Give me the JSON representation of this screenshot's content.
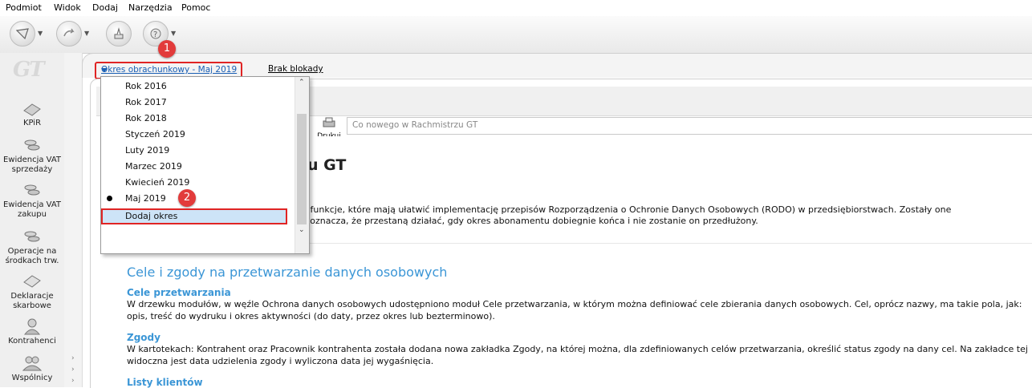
{
  "menu": [
    "Podmiot",
    "Widok",
    "Dodaj",
    "Narzędzia",
    "Pomoc"
  ],
  "toolbar": {
    "icons": [
      "mail-icon",
      "forward-icon",
      "tools-icon",
      "help-icon"
    ]
  },
  "logo": "GT",
  "nav": [
    {
      "label": "KPiR",
      "icon": "book-icon"
    },
    {
      "label": "Ewidencja VAT sprzedaży",
      "icon": "coins-icon"
    },
    {
      "label": "Ewidencja VAT zakupu",
      "icon": "coins-icon"
    },
    {
      "label": "Operacje na środkach trw.",
      "icon": "coins-icon"
    },
    {
      "label": "Deklaracje skarbowe",
      "icon": "document-icon"
    },
    {
      "label": "Kontrahenci",
      "icon": "person-icon"
    },
    {
      "label": "Wspólnicy",
      "icon": "people-icon"
    }
  ],
  "period": {
    "label": "Okres obrachunkowy - Maj 2019",
    "lock": "Brak blokady"
  },
  "dropdown": {
    "items": [
      "Rok 2016",
      "Rok 2017",
      "Rok 2018",
      "Styczeń 2019",
      "Luty 2019",
      "Marzec 2019",
      "Kwiecień 2019",
      "Maj 2019"
    ],
    "selected": "Maj 2019",
    "add": "Dodaj okres"
  },
  "markers": [
    "1",
    "2"
  ],
  "print_label": "Drukuj",
  "address": "Co nowego w Rachmistrzu GT",
  "content": {
    "title_fragment": "u GT",
    "intro_line1": "y i funkcje, które mają ułatwić implementację przepisów Rozporządzenia o Ochronie Danych Osobowych (RODO) w przedsiębiorstwach. Zostały one",
    "intro_line2": "co oznacza, że przestaną działać, gdy okres abonamentu dobiegnie końca i nie zostanie on przedłużony.",
    "section_title": "Cele i zgody na przetwarzanie danych osobowych",
    "s1_title": "Cele przetwarzania",
    "s1_line1": "W drzewku modułów, w węźle Ochrona danych osobowych udostępniono moduł Cele przetwarzania, w którym można definiować cele zbierania danych osobowych. Cel, oprócz nazwy, ma takie pola, jak:",
    "s1_line2": "opis, treść do wydruku i okres aktywności (do daty, przez okres lub bezterminowo).",
    "s2_title": "Zgody",
    "s2_line1": "W kartotekach: Kontrahent oraz Pracownik kontrahenta została dodana nowa zakładka Zgody, na której można, dla zdefiniowanych celów przetwarzania, określić status zgody na dany cel. Na zakładce tej",
    "s2_line2": "widoczna jest data udzielenia zgody i wyliczona data jej wygaśnięcia.",
    "s3_title": "Listy klientów"
  }
}
